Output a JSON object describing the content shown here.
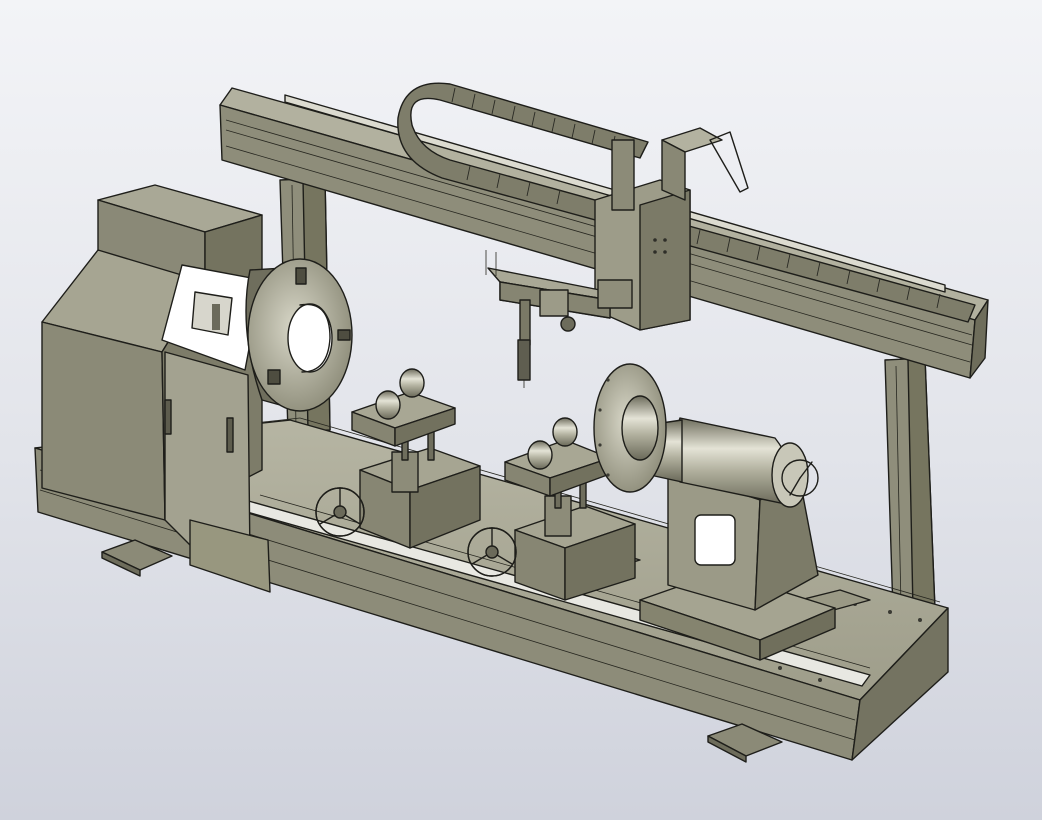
{
  "scene": {
    "view": "isometric-cad-model",
    "colors": {
      "background_top": "#f3f4f7",
      "background_bottom": "#cfd2dc",
      "metal_light": "#a8a795",
      "metal_mid": "#8c8b78",
      "metal_dark": "#6f6e5d",
      "edge": "#1e1e1a",
      "panel_white": "#ffffff"
    },
    "components": [
      "bed-frame",
      "headstock",
      "chuck",
      "gantry-beam",
      "cable-drag-chain",
      "welding-torch",
      "roller-support-left",
      "roller-support-right",
      "handwheel-left",
      "handwheel-right",
      "tailstock",
      "faceplate",
      "gantry-leg-left",
      "gantry-leg-right",
      "foot-plate"
    ]
  }
}
